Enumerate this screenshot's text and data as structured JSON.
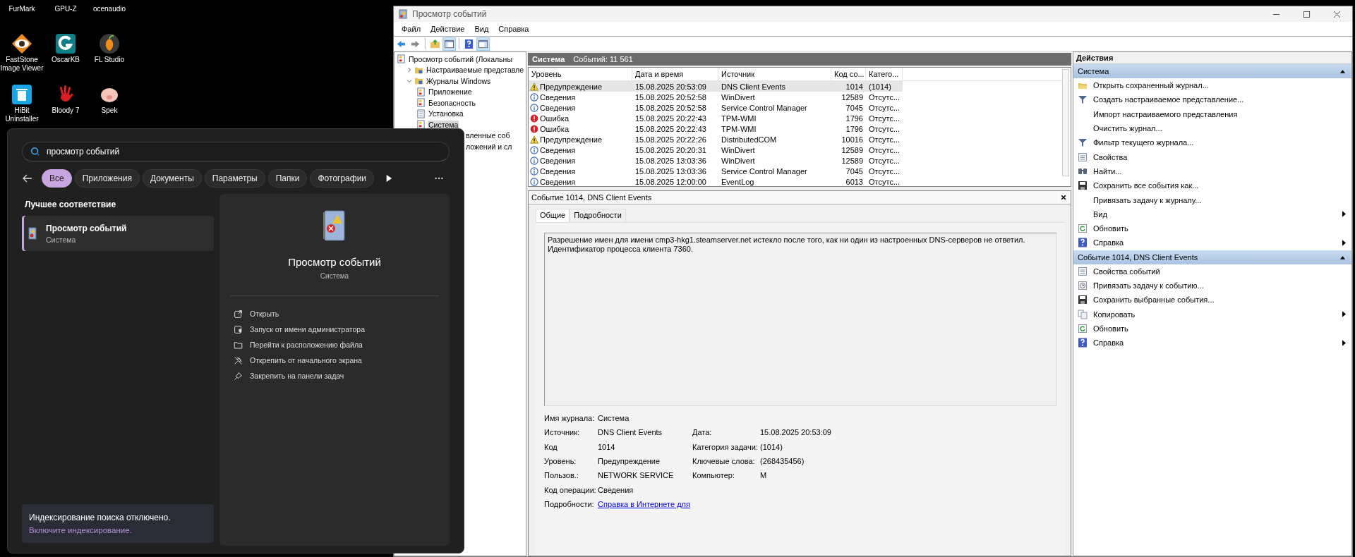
{
  "desktop": {
    "icons": [
      {
        "label": "FurMark",
        "kind": "hidden"
      },
      {
        "label": "GPU-Z",
        "kind": "hidden"
      },
      {
        "label": "ocenaudio",
        "kind": "hidden"
      },
      {
        "label": "FastStone Image Viewer",
        "kind": "eye"
      },
      {
        "label": "OscarKB",
        "kind": "teal"
      },
      {
        "label": "FL Studio",
        "kind": "fruit"
      },
      {
        "label": "HiBit Uninstaller",
        "kind": "bin"
      },
      {
        "label": "Bloody 7",
        "kind": "hand"
      },
      {
        "label": "Spek",
        "kind": "pig"
      }
    ]
  },
  "event_viewer": {
    "title": "Просмотр событий",
    "menu": [
      "Файл",
      "Действие",
      "Вид",
      "Справка"
    ],
    "tree": [
      {
        "label": "Просмотр событий (Локальны",
        "kind": "root",
        "selected": false,
        "children": [
          {
            "label": "Настраиваемые представле",
            "kind": "folder",
            "expanded": false,
            "selected": false
          },
          {
            "label": "Журналы Windows",
            "kind": "folder",
            "expanded": true,
            "selected": false,
            "children": [
              {
                "label": "Приложение",
                "kind": "log",
                "selected": false
              },
              {
                "label": "Безопасность",
                "kind": "log",
                "selected": false
              },
              {
                "label": "Установка",
                "kind": "plain",
                "selected": false
              },
              {
                "label": "Система",
                "kind": "log",
                "selected": true
              },
              {
                "label": "вленные соб",
                "kind": "cut",
                "selected": false
              }
            ]
          },
          {
            "label": "ложений и сл",
            "kind": "cut",
            "selected": false
          }
        ]
      }
    ],
    "log_header": {
      "name": "Система",
      "count": "Событий: 11 561"
    },
    "columns": [
      "Уровень",
      "Дата и время",
      "Источник",
      "Код со...",
      "Катего..."
    ],
    "rows": [
      {
        "kind": "warning",
        "selected": true,
        "cells": [
          "Предупреждение",
          "15.08.2025 20:53:09",
          "DNS Client Events",
          "1014",
          "(1014)"
        ]
      },
      {
        "kind": "info",
        "selected": false,
        "cells": [
          "Сведения",
          "15.08.2025 20:52:58",
          "WinDivert",
          "12589",
          "Отсутс..."
        ]
      },
      {
        "kind": "info",
        "selected": false,
        "cells": [
          "Сведения",
          "15.08.2025 20:52:58",
          "Service Control Manager",
          "7045",
          "Отсутс..."
        ]
      },
      {
        "kind": "error",
        "selected": false,
        "cells": [
          "Ошибка",
          "15.08.2025 20:22:43",
          "TPM-WMI",
          "1796",
          "Отсутс..."
        ]
      },
      {
        "kind": "error",
        "selected": false,
        "cells": [
          "Ошибка",
          "15.08.2025 20:22:43",
          "TPM-WMI",
          "1796",
          "Отсутс..."
        ]
      },
      {
        "kind": "warning",
        "selected": false,
        "cells": [
          "Предупреждение",
          "15.08.2025 20:22:26",
          "DistributedCOM",
          "10016",
          "Отсутс..."
        ]
      },
      {
        "kind": "info",
        "selected": false,
        "cells": [
          "Сведения",
          "15.08.2025 20:20:31",
          "WinDivert",
          "12589",
          "Отсутс..."
        ]
      },
      {
        "kind": "info",
        "selected": false,
        "cells": [
          "Сведения",
          "15.08.2025 13:03:36",
          "WinDivert",
          "12589",
          "Отсутс..."
        ]
      },
      {
        "kind": "info",
        "selected": false,
        "cells": [
          "Сведения",
          "15.08.2025 13:03:36",
          "Service Control Manager",
          "7045",
          "Отсутс..."
        ]
      },
      {
        "kind": "info",
        "selected": false,
        "cells": [
          "Сведения",
          "15.08.2025 12:00:00",
          "EventLog",
          "6013",
          "Отсутс..."
        ]
      }
    ],
    "detail": {
      "title": "Событие 1014, DNS Client Events",
      "tabs": [
        {
          "label": "Общие",
          "selected": true
        },
        {
          "label": "Подробности",
          "selected": false
        }
      ],
      "message": "Разрешение имен для имени cmp3-hkg1.steamserver.net истекло после того, как ни один из настроенных DNS-серверов не ответил. Идентификатор процесса клиента 7360.",
      "field_rows": [
        {
          "left": {
            "label": "Имя журнала:",
            "value": "Система"
          }
        },
        {
          "left": {
            "label": "Источник:",
            "value": "DNS Client Events"
          },
          "right": {
            "label": "Дата:",
            "value": "15.08.2025 20:53:09"
          }
        },
        {
          "left": {
            "label": "Код",
            "value": "1014"
          },
          "right": {
            "label": "Категория задачи:",
            "value": "(1014)"
          }
        },
        {
          "left": {
            "label": "Уровень:",
            "value": "Предупреждение"
          },
          "right": {
            "label": "Ключевые слова:",
            "value": "(268435456)"
          }
        },
        {
          "left": {
            "label": "Пользов.:",
            "value": "NETWORK SERVICE"
          },
          "right": {
            "label": "Компьютер:",
            "value": "M"
          }
        },
        {
          "left": {
            "label": "Код операции:",
            "value": "Сведения"
          }
        },
        {
          "left": {
            "label": "Подробности:",
            "value": "Справка в Интернете для",
            "kind": "link"
          }
        }
      ]
    },
    "actions": {
      "title": "Действия",
      "groups": [
        {
          "title": "Система",
          "expanded": true,
          "items": [
            {
              "label": "Открыть сохраненный журнал...",
              "submenu": false
            },
            {
              "label": "Создать настраиваемое представление...",
              "submenu": false
            },
            {
              "label": "Импорт настраиваемого представления",
              "submenu": false
            },
            {
              "label": "Очистить журнал...",
              "submenu": false
            },
            {
              "label": "Фильтр текущего журнала...",
              "submenu": false
            },
            {
              "label": "Свойства",
              "submenu": false
            },
            {
              "label": "Найти...",
              "submenu": false
            },
            {
              "label": "Сохранить все события как...",
              "submenu": false
            },
            {
              "label": "Привязать задачу к журналу...",
              "submenu": false
            },
            {
              "label": "Вид",
              "submenu": true
            },
            {
              "label": "Обновить",
              "submenu": false
            },
            {
              "label": "Справка",
              "submenu": true
            }
          ]
        },
        {
          "title": "Событие 1014, DNS Client Events",
          "expanded": true,
          "items": [
            {
              "label": "Свойства событий",
              "submenu": false
            },
            {
              "label": "Привязать задачу к событию...",
              "submenu": false
            },
            {
              "label": "Сохранить выбранные события...",
              "submenu": false
            },
            {
              "label": "Копировать",
              "submenu": true
            },
            {
              "label": "Обновить",
              "submenu": false
            },
            {
              "label": "Справка",
              "submenu": true
            }
          ]
        }
      ]
    }
  },
  "search": {
    "query": "просмотр событий",
    "filters": [
      {
        "label": "Все",
        "selected": true
      },
      {
        "label": "Приложения",
        "selected": false
      },
      {
        "label": "Документы",
        "selected": false
      },
      {
        "label": "Параметры",
        "selected": false
      },
      {
        "label": "Папки",
        "selected": false
      },
      {
        "label": "Фотографии",
        "selected": false
      }
    ],
    "best_match_heading": "Лучшее соответствие",
    "best_match": {
      "title": "Просмотр событий",
      "subtitle": "Система",
      "selected": true
    },
    "preview": {
      "title": "Просмотр событий",
      "subtitle": "Система",
      "actions": [
        {
          "label": "Открыть"
        },
        {
          "label": "Запуск от имени администратора"
        },
        {
          "label": "Перейти к расположению файла"
        },
        {
          "label": "Открепить от начального экрана"
        },
        {
          "label": "Закрепить на панели задач"
        }
      ]
    },
    "notice": {
      "text": "Индексирование поиска отключено.",
      "link": "Включите индексирование."
    }
  }
}
